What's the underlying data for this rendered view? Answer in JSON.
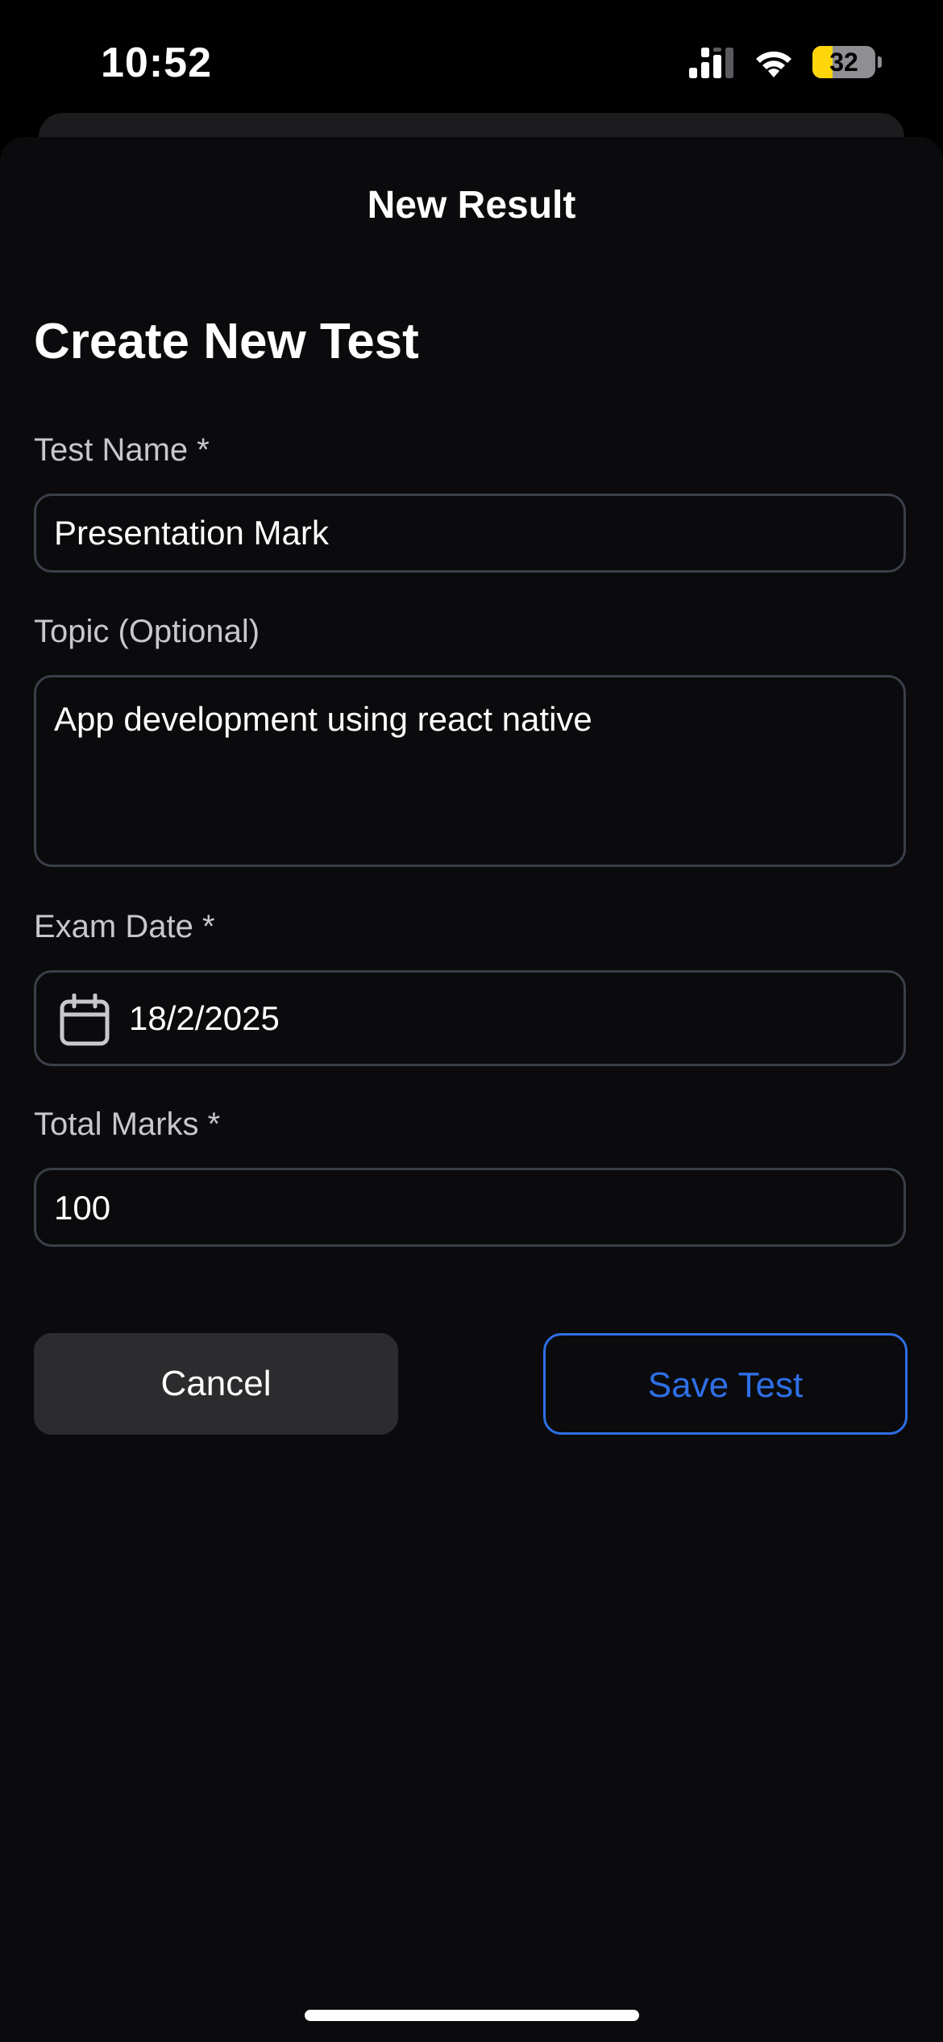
{
  "status_bar": {
    "time": "10:52",
    "battery_level": 32,
    "battery_label": "32",
    "battery_fill_color": "#ffd60a",
    "icons": [
      "signal-icon",
      "wifi-icon",
      "battery-icon"
    ]
  },
  "sheet": {
    "title": "New Result"
  },
  "form": {
    "heading": "Create New Test",
    "test_name": {
      "label": "Test Name *",
      "value": "Presentation Mark"
    },
    "topic": {
      "label": "Topic (Optional)",
      "value": "App development using react native"
    },
    "exam_date": {
      "label": "Exam Date *",
      "value": "18/2/2025",
      "icon": "calendar-icon"
    },
    "total_marks": {
      "label": "Total Marks *",
      "value": "100"
    }
  },
  "actions": {
    "cancel_label": "Cancel",
    "save_label": "Save Test",
    "accent_color": "#2f6fe6"
  }
}
